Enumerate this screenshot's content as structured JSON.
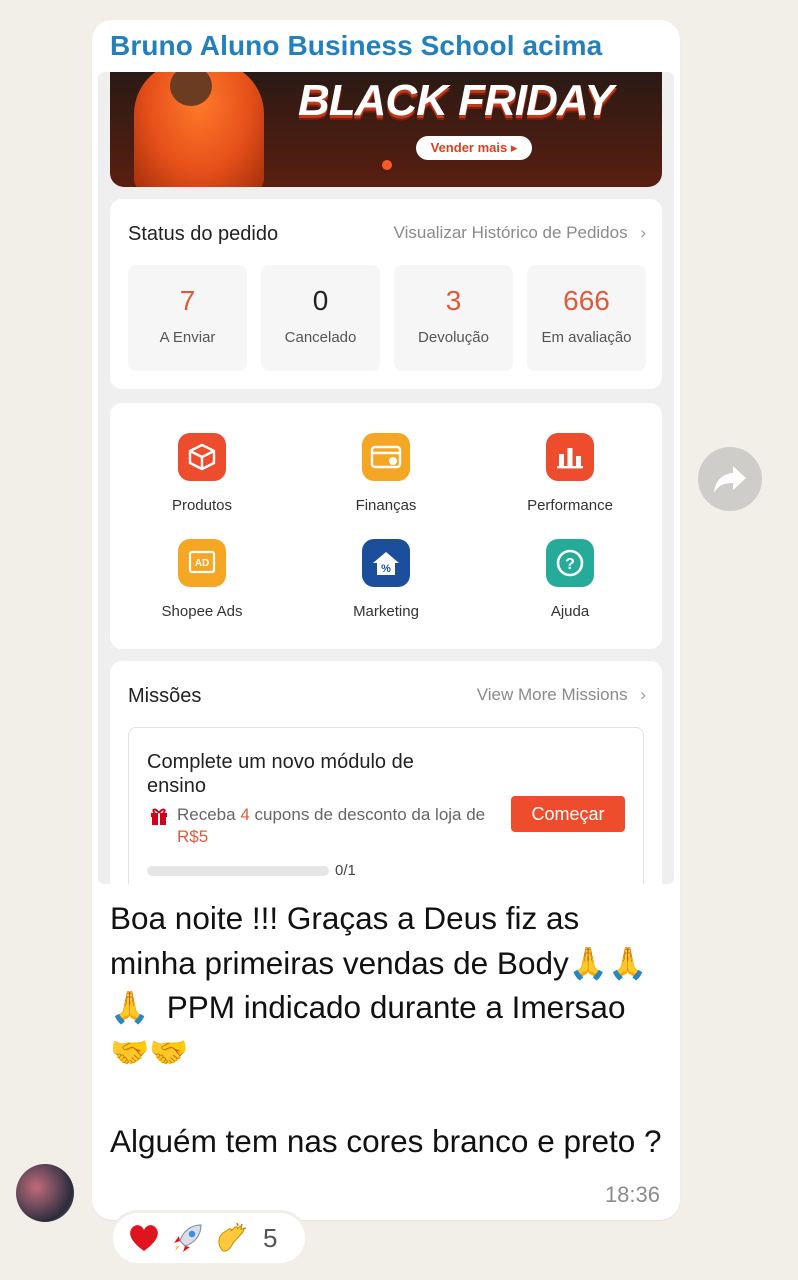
{
  "sender": "Bruno Aluno Business School acima",
  "banner": {
    "title": "BLACK FRIDAY",
    "button": "Vender mais ▸"
  },
  "status": {
    "title": "Status do pedido",
    "link": "Visualizar Histórico de Pedidos",
    "items": [
      {
        "value": "7",
        "label": "A Enviar"
      },
      {
        "value": "0",
        "label": "Cancelado"
      },
      {
        "value": "3",
        "label": "Devolução"
      },
      {
        "value": "666",
        "label": "Em avaliação"
      }
    ]
  },
  "tools": [
    {
      "label": "Produtos",
      "icon": "box-icon",
      "color": "#ee4d2d"
    },
    {
      "label": "Finanças",
      "icon": "wallet-icon",
      "color": "#f5a623"
    },
    {
      "label": "Performance",
      "icon": "bar-chart-icon",
      "color": "#ee4d2d"
    },
    {
      "label": "Shopee Ads",
      "icon": "ad-icon",
      "color": "#f5a623"
    },
    {
      "label": "Marketing",
      "icon": "discount-house-icon",
      "color": "#1b4f9c"
    },
    {
      "label": "Ajuda",
      "icon": "help-icon",
      "color": "#26aa99"
    }
  ],
  "missions": {
    "title": "Missões",
    "link": "View More Missions",
    "task": {
      "title": "Complete um novo módulo de ensino",
      "desc_prefix": "Receba ",
      "desc_count": "4",
      "desc_middle": " cupons de desconto da loja de ",
      "desc_amount": "R$5",
      "button": "Começar",
      "progress": 0,
      "progress_label": "0/1"
    }
  },
  "message": {
    "text": "Boa noite !!! Graças a Deus fiz as minha primeiras vendas de Body🙏🙏🙏  PPM indicado durante a Imersao 🤝🤝\n\nAlguém tem nas cores branco e preto ?",
    "time": "18:36"
  },
  "reactions": {
    "emojis": [
      "❤️",
      "🚀",
      "👏"
    ],
    "count": "5"
  },
  "colors": {
    "sender": "#2281bd",
    "accent": "#ee4d2d",
    "bg": "#f2eee8"
  }
}
